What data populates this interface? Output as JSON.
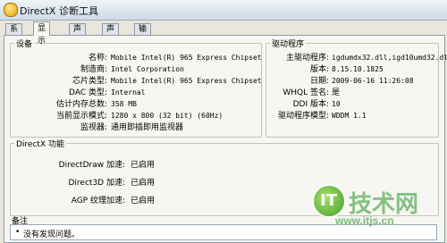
{
  "window": {
    "title": "DirectX 诊断工具"
  },
  "tabs": [
    {
      "label": "系统"
    },
    {
      "label": "显示"
    },
    {
      "label": "声音 1"
    },
    {
      "label": "声音 2"
    },
    {
      "label": "输入"
    }
  ],
  "device": {
    "title": "设备",
    "rows": [
      {
        "label": "名称:",
        "value": "Mobile Intel(R) 965 Express Chipset"
      },
      {
        "label": "制造商:",
        "value": "Intel Corporation"
      },
      {
        "label": "芯片类型:",
        "value": "Mobile Intel(R) 965 Express Chipset"
      },
      {
        "label": "DAC 类型:",
        "value": "Internal"
      },
      {
        "label": "估计内存总数:",
        "value": "358 MB"
      },
      {
        "label": "当前显示模式:",
        "value": "1280 x 800 (32 bit) (60Hz)"
      },
      {
        "label": "监视器:",
        "value": "通用即插即用监视器"
      }
    ]
  },
  "driver": {
    "title": "驱动程序",
    "rows": [
      {
        "label": "主驱动程序:",
        "value": "igdumdx32.dll,igd10umd32.dll"
      },
      {
        "label": "版本:",
        "value": "8.15.10.1825"
      },
      {
        "label": "日期:",
        "value": "2009-06-16 11:26:08"
      },
      {
        "label": "WHQL 签名:",
        "value": "是"
      },
      {
        "label": "DDI 版本:",
        "value": "10"
      },
      {
        "label": "驱动程序模型:",
        "value": "WDDM 1.1"
      }
    ]
  },
  "directx": {
    "title": "DirectX 功能",
    "rows": [
      {
        "label": "DirectDraw 加速:",
        "value": "已启用"
      },
      {
        "label": "Direct3D 加速:",
        "value": "已启用"
      },
      {
        "label": "AGP 纹理加速:",
        "value": "已启用"
      }
    ]
  },
  "notes": {
    "title": "备注",
    "items": [
      "没有发现问题。"
    ]
  },
  "watermark": {
    "logo_letter": "IT",
    "cn": "技术网",
    "url": "www.itjs.cn"
  }
}
